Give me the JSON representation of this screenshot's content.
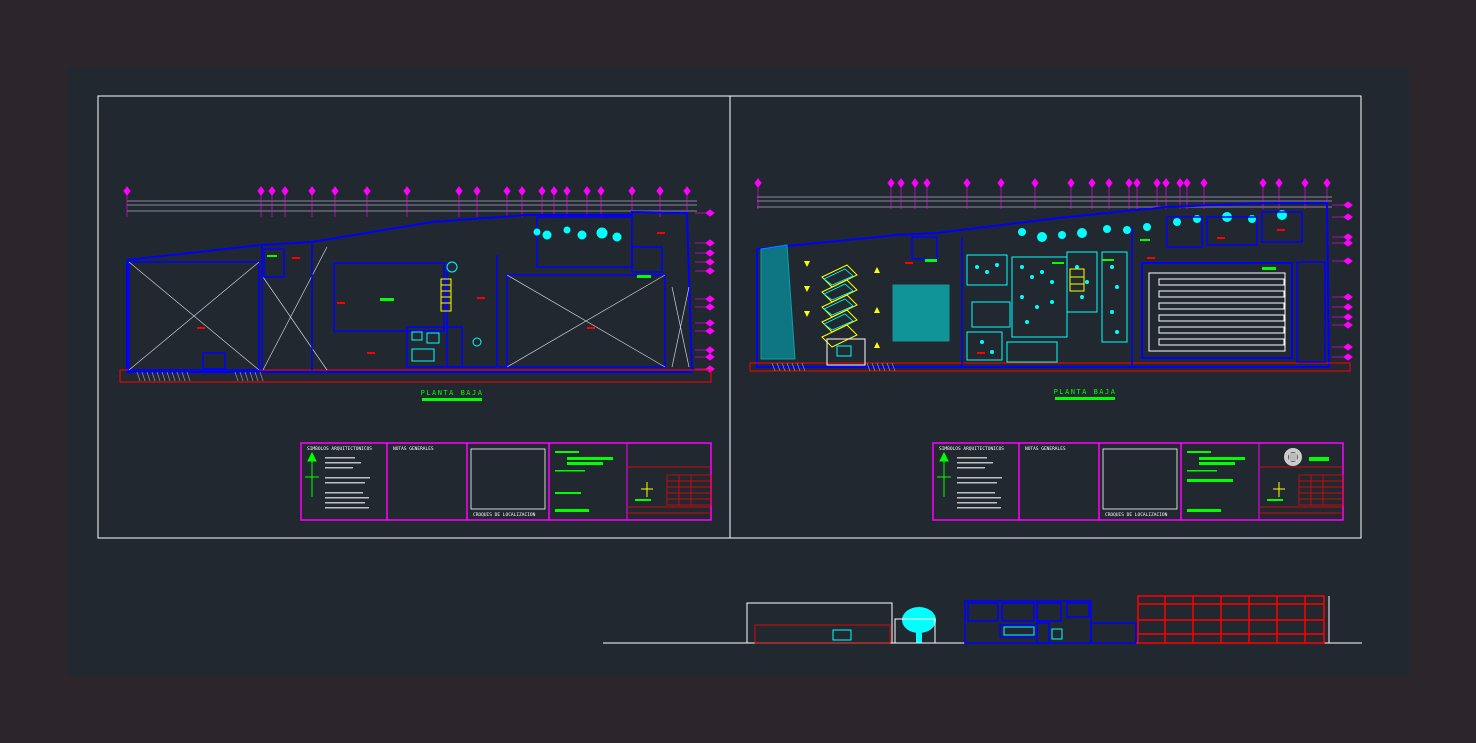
{
  "colors": {
    "outer_bg": "#2c262c",
    "model_bg": "#212830",
    "sheet_border": "#ffffff",
    "wall_blue": "#0000ff",
    "axis_magenta": "#ff00ff",
    "furniture_cyan": "#00ffff",
    "label_green": "#00ff00",
    "tag_red": "#ff0000",
    "accent_yellow": "#ffff00",
    "facade_red": "#ff0000"
  },
  "sheets": [
    {
      "plan_title": "PLANTA BAJA",
      "title_block": {
        "symbols_title": "SIMBOLOS ARQUITECTONICOS",
        "notes_title": "NOTAS GENERALES",
        "location_title": "CROQUIS DE LOCALIZACION"
      }
    },
    {
      "plan_title": "PLANTA BAJA",
      "title_block": {
        "symbols_title": "SIMBOLOS ARQUITECTONICOS",
        "notes_title": "NOTAS GENERALES",
        "location_title": "CROQUIS DE LOCALIZACION"
      }
    }
  ],
  "icons": {
    "north_arrow": "north-arrow-icon",
    "logo": "logo-icon",
    "tree": "tree-icon"
  }
}
